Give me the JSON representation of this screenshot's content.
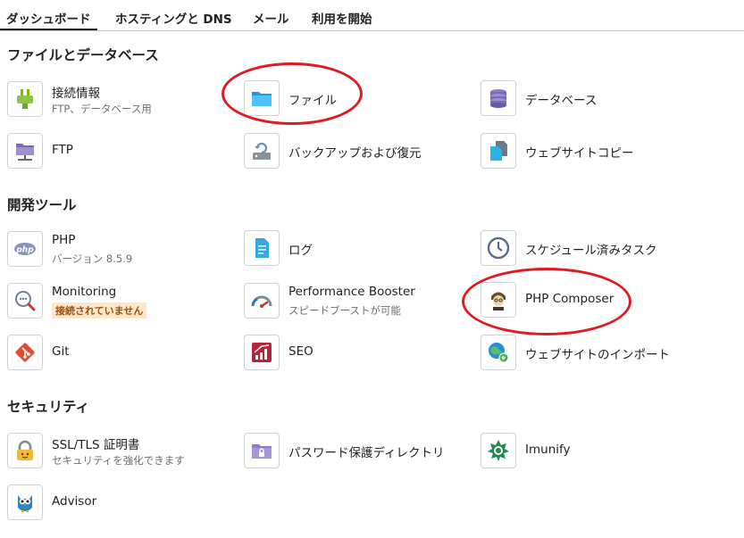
{
  "tabs": [
    {
      "label": "ダッシュボード"
    },
    {
      "label": "ホスティングと DNS"
    },
    {
      "label": "メール"
    },
    {
      "label": "利用を開始"
    }
  ],
  "sections": {
    "files": {
      "title": "ファイルとデータベース",
      "items": {
        "connection": {
          "label": "接続情報",
          "sub": "FTP、データベース用",
          "icon": "plug-icon"
        },
        "files": {
          "label": "ファイル",
          "icon": "folder-icon"
        },
        "databases": {
          "label": "データベース",
          "icon": "database-icon"
        },
        "ftp": {
          "label": "FTP",
          "icon": "ftp-folder-icon"
        },
        "backup": {
          "label": "バックアップおよび復元",
          "icon": "backup-icon"
        },
        "website_copy": {
          "label": "ウェブサイトコピー",
          "icon": "copy-icon"
        }
      }
    },
    "dev": {
      "title": "開発ツール",
      "items": {
        "php": {
          "label": "PHP",
          "sub": "バージョン 8.5.9",
          "icon": "php-icon"
        },
        "logs": {
          "label": "ログ",
          "icon": "log-file-icon"
        },
        "scheduled": {
          "label": "スケジュール済みタスク",
          "icon": "clock-icon"
        },
        "monitoring": {
          "label": "Monitoring",
          "badge": "接続されていません",
          "icon": "monitoring-icon"
        },
        "performance": {
          "label": "Performance Booster",
          "sub": "スピードブーストが可能",
          "icon": "speedometer-icon"
        },
        "composer": {
          "label": "PHP Composer",
          "icon": "composer-icon"
        },
        "git": {
          "label": "Git",
          "icon": "git-icon"
        },
        "seo": {
          "label": "SEO",
          "icon": "seo-chart-icon"
        },
        "import": {
          "label": "ウェブサイトのインポート",
          "icon": "globe-import-icon"
        }
      }
    },
    "security": {
      "title": "セキュリティ",
      "items": {
        "ssl": {
          "label": "SSL/TLS 証明書",
          "sub": "セキュリティを強化できます",
          "icon": "lock-icon"
        },
        "password_dirs": {
          "label": "パスワード保護ディレクトリ",
          "icon": "locked-folder-icon"
        },
        "imunify": {
          "label": "Imunify",
          "icon": "imunify-icon"
        },
        "advisor": {
          "label": "Advisor",
          "icon": "owl-icon"
        }
      }
    }
  },
  "colors": {
    "annotation": "#e01a22",
    "badge_bg": "#fde6cc",
    "badge_text": "#a0500a"
  }
}
